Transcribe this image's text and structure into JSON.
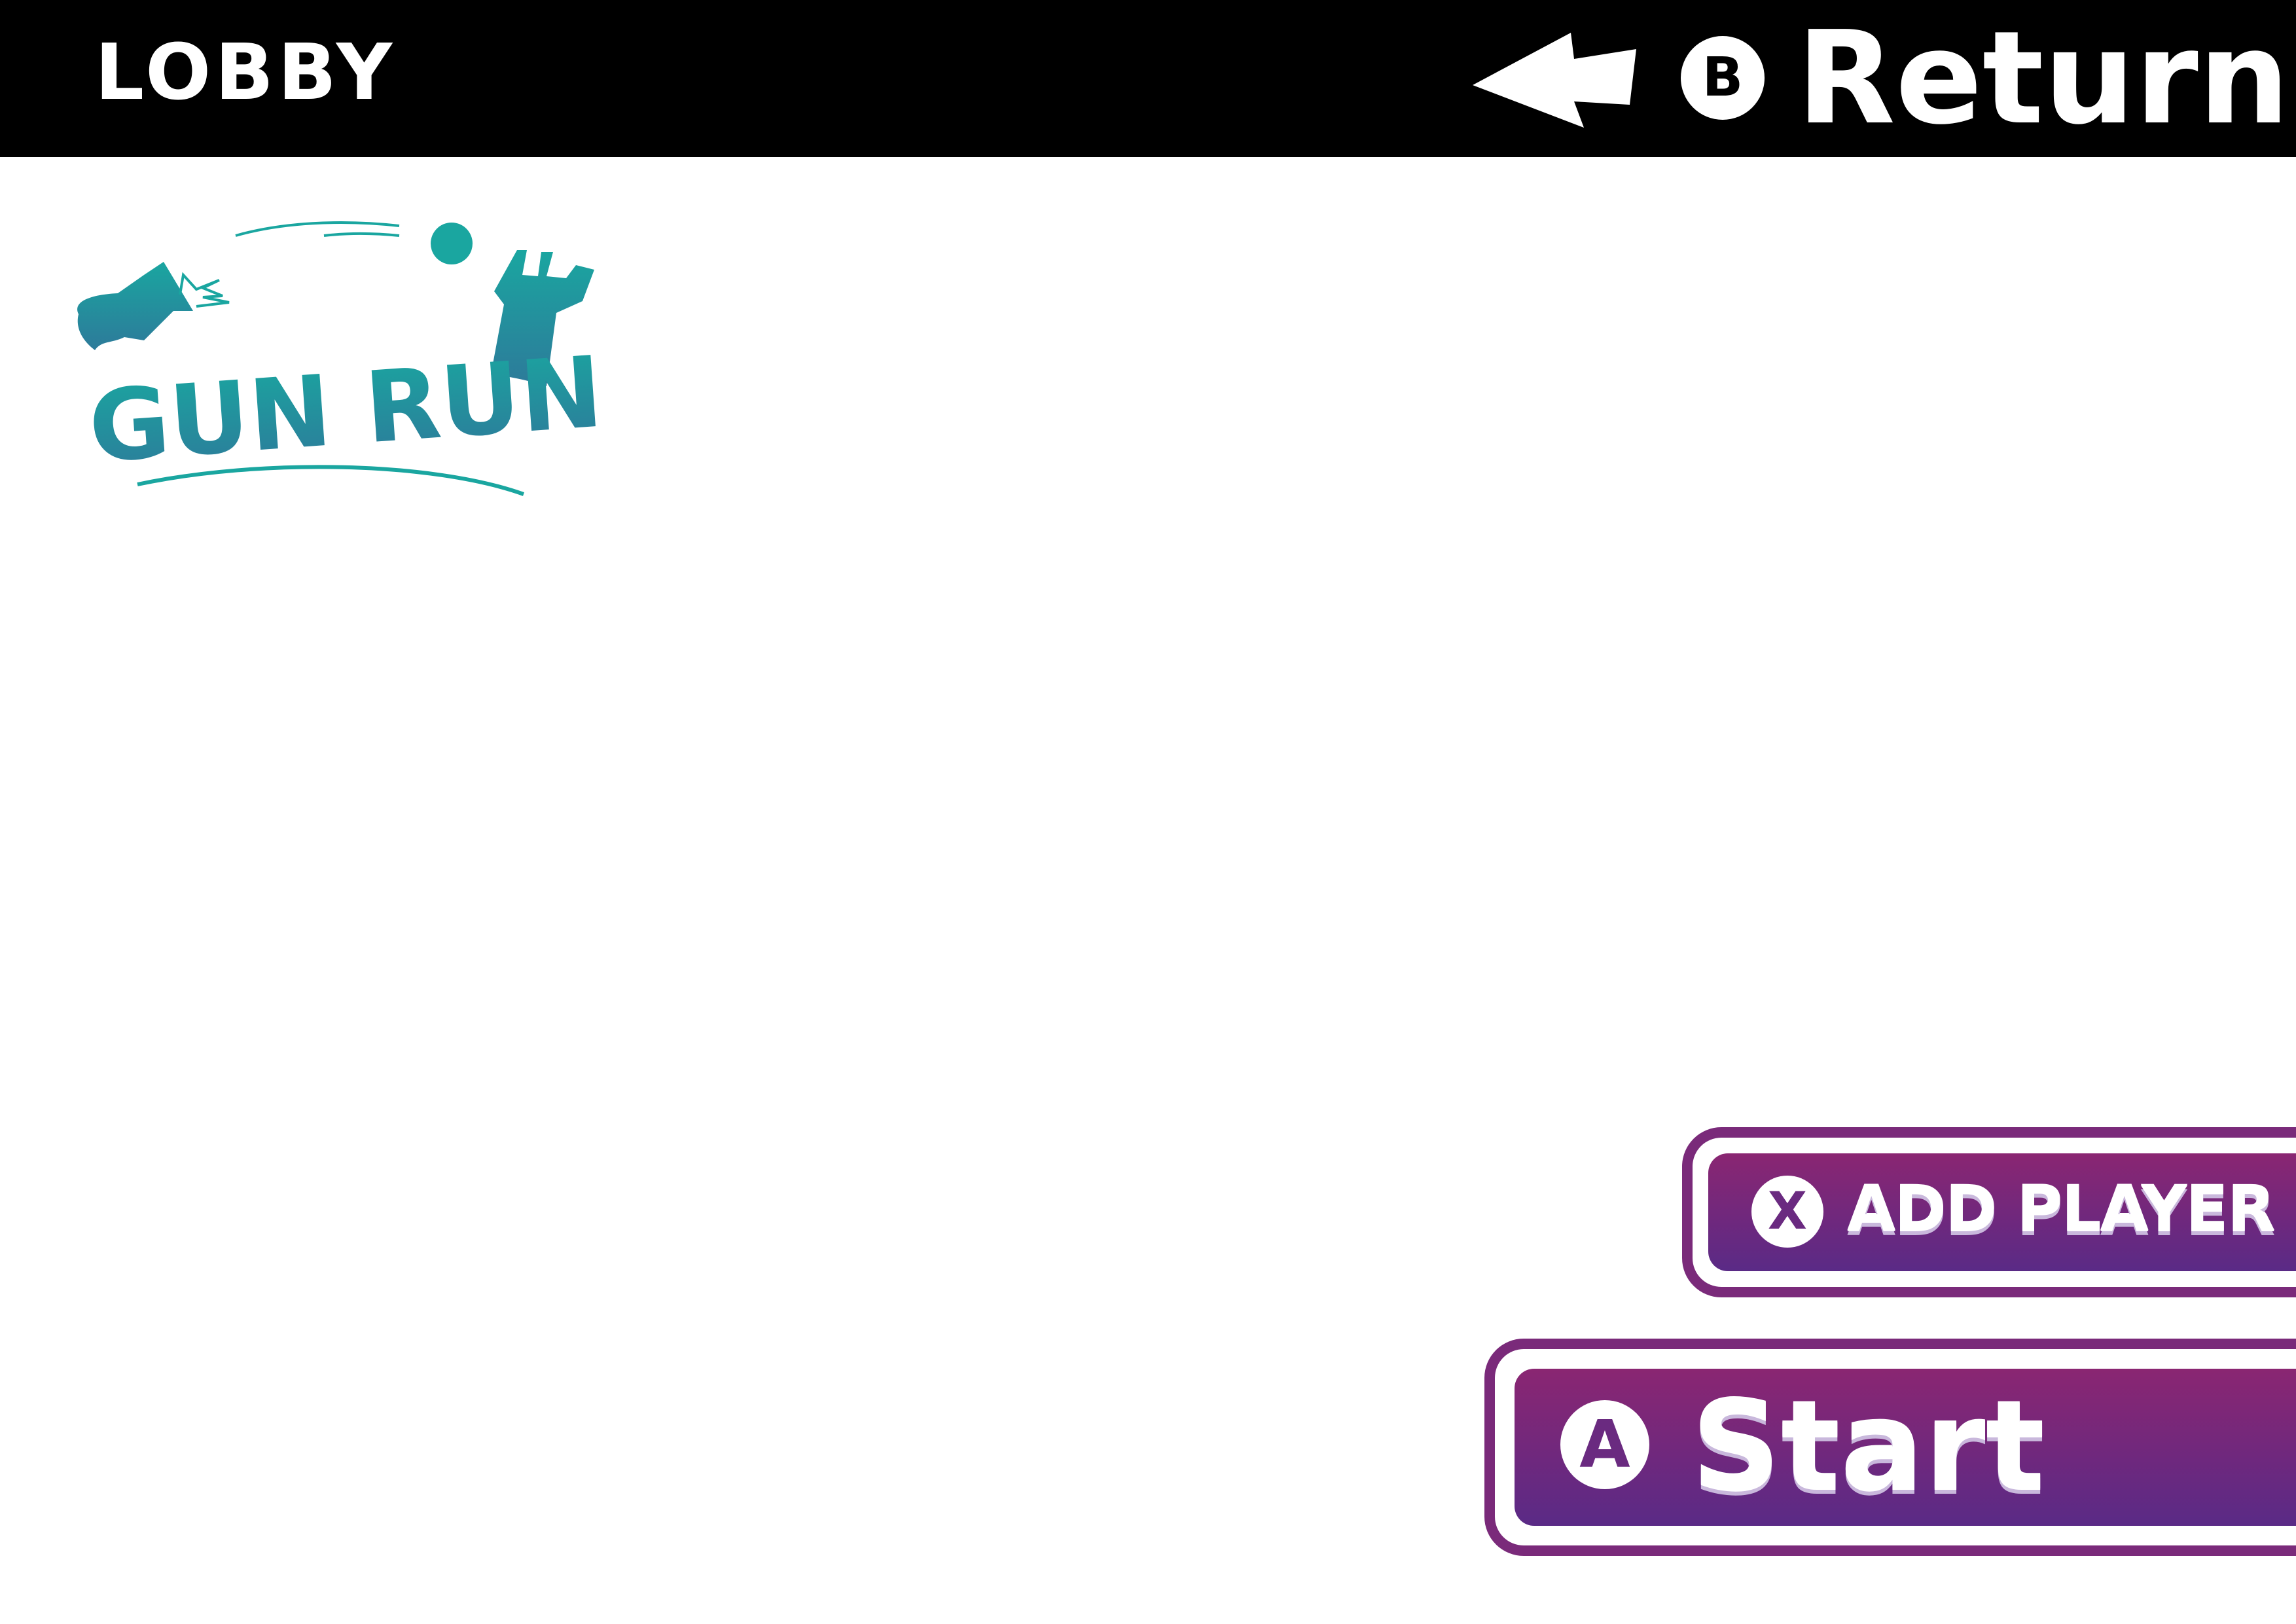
{
  "screen": {
    "title": "LOBBY"
  },
  "header": {
    "return_button": {
      "key": "B",
      "label": "Return",
      "icon": "back-arrow-icon"
    }
  },
  "logo": {
    "text": "GUN RUN",
    "color": "#1aa6a0"
  },
  "actions": {
    "add_player": {
      "key": "X",
      "label": "ADD PLAYER"
    },
    "start": {
      "key": "A",
      "label": "Start"
    }
  },
  "colors": {
    "topbar": "#000000",
    "button_gradient_top": "#8a2672",
    "button_gradient_bottom": "#5a2a86",
    "logo_teal": "#1aa6a0"
  }
}
